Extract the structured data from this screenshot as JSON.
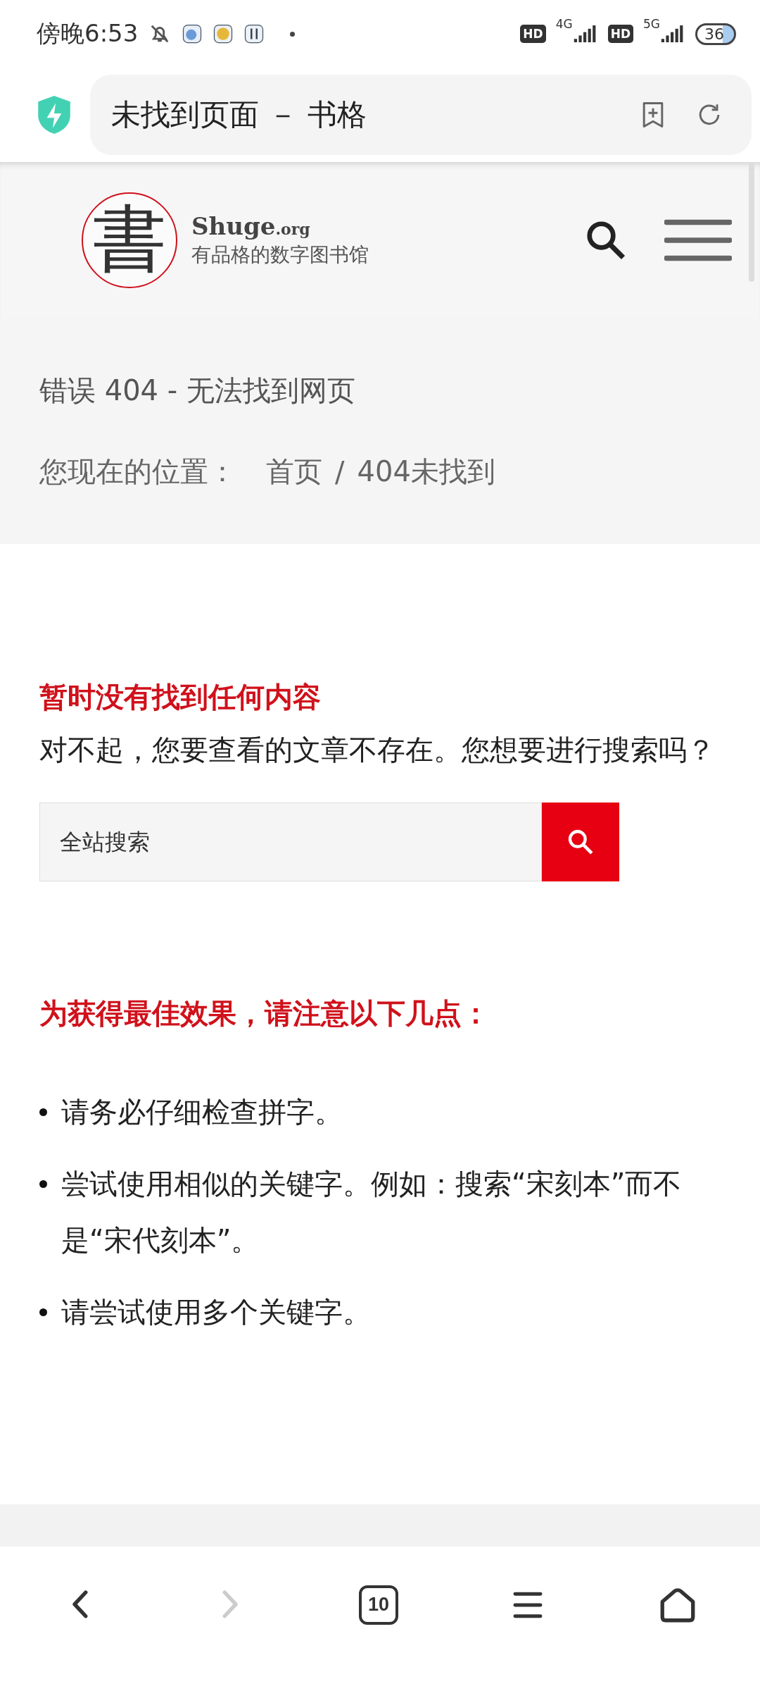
{
  "status_bar": {
    "time": "傍晚6:53",
    "network_1": {
      "hd": "HD",
      "type": "4G"
    },
    "network_2": {
      "hd": "HD",
      "type": "5G"
    },
    "battery": "36"
  },
  "address_bar": {
    "title": "未找到页面 － 书格"
  },
  "site_header": {
    "logo_glyph": "書",
    "logo_name": "Shuge",
    "logo_domain": ".org",
    "tagline": "有品格的数字图书馆"
  },
  "page_title": "错误 404 - 无法找到网页",
  "breadcrumb": {
    "label": "您现在的位置：",
    "links": [
      "首页"
    ],
    "separator": "/",
    "current": "404未找到"
  },
  "notice": {
    "heading": "暂时没有找到任何内容",
    "text": "对不起，您要查看的文章不存在。您想要进行搜索吗？"
  },
  "search": {
    "placeholder": "全站搜索"
  },
  "tips": {
    "heading": "为获得最佳效果，请注意以下几点：",
    "items": [
      "请务必仔细检查拼字。",
      "尝试使用相似的关键字。例如：搜索“宋刻本”而不是“宋代刻本”。",
      "请尝试使用多个关键字。"
    ]
  },
  "nav_bar": [
    {
      "kind": "back",
      "disabled": false
    },
    {
      "kind": "forward",
      "disabled": true
    },
    {
      "kind": "tabs",
      "count": "10",
      "disabled": false
    },
    {
      "kind": "menu",
      "disabled": false
    },
    {
      "kind": "home",
      "disabled": false
    }
  ]
}
